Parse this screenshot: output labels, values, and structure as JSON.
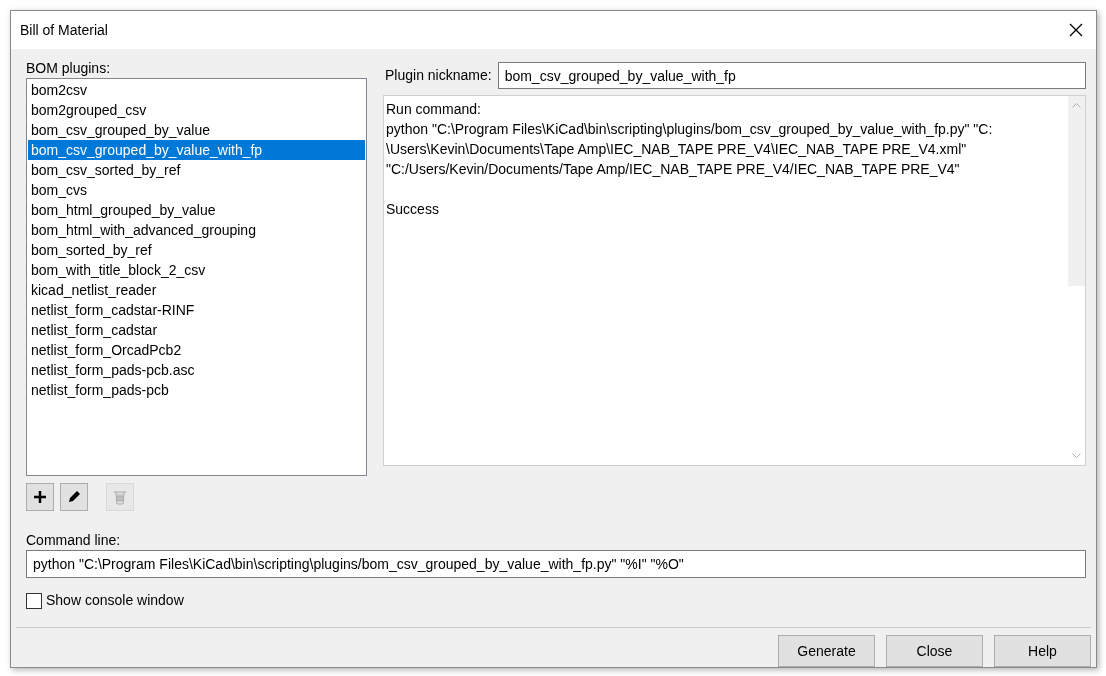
{
  "window": {
    "title": "Bill of Material"
  },
  "plugins": {
    "label": "BOM plugins:",
    "items": [
      {
        "label": "bom2csv",
        "selected": false
      },
      {
        "label": "bom2grouped_csv",
        "selected": false
      },
      {
        "label": "bom_csv_grouped_by_value",
        "selected": false
      },
      {
        "label": "bom_csv_grouped_by_value_with_fp",
        "selected": true
      },
      {
        "label": "bom_csv_sorted_by_ref",
        "selected": false
      },
      {
        "label": "bom_cvs",
        "selected": false
      },
      {
        "label": "bom_html_grouped_by_value",
        "selected": false
      },
      {
        "label": "bom_html_with_advanced_grouping",
        "selected": false
      },
      {
        "label": "bom_sorted_by_ref",
        "selected": false
      },
      {
        "label": "bom_with_title_block_2_csv",
        "selected": false
      },
      {
        "label": "kicad_netlist_reader",
        "selected": false
      },
      {
        "label": "netlist_form_cadstar-RINF",
        "selected": false
      },
      {
        "label": "netlist_form_cadstar",
        "selected": false
      },
      {
        "label": "netlist_form_OrcadPcb2",
        "selected": false
      },
      {
        "label": "netlist_form_pads-pcb.asc",
        "selected": false
      },
      {
        "label": "netlist_form_pads-pcb",
        "selected": false
      }
    ]
  },
  "list_tools": [
    {
      "kind": "add",
      "disabled": false
    },
    {
      "kind": "edit",
      "disabled": false
    },
    {
      "kind": "delete",
      "disabled": true
    }
  ],
  "nickname": {
    "label": "Plugin nickname:",
    "value": "bom_csv_grouped_by_value_with_fp"
  },
  "output_lines": [
    "Run command:",
    "python \"C:\\Program Files\\KiCad\\bin\\scripting\\plugins/bom_csv_grouped_by_value_with_fp.py\" \"C:",
    "\\Users\\Kevin\\Documents\\Tape Amp\\IEC_NAB_TAPE PRE_V4\\IEC_NAB_TAPE PRE_V4.xml\"",
    "\"C:/Users/Kevin/Documents/Tape Amp/IEC_NAB_TAPE PRE_V4/IEC_NAB_TAPE PRE_V4\""
  ],
  "output_result": "Success",
  "command_line": {
    "label": "Command line:",
    "value": "python \"C:\\Program Files\\KiCad\\bin\\scripting\\plugins/bom_csv_grouped_by_value_with_fp.py\" \"%I\" \"%O\""
  },
  "show_console": {
    "label": "Show console window",
    "checked": false
  },
  "buttons": [
    "Generate",
    "Close",
    "Help"
  ]
}
